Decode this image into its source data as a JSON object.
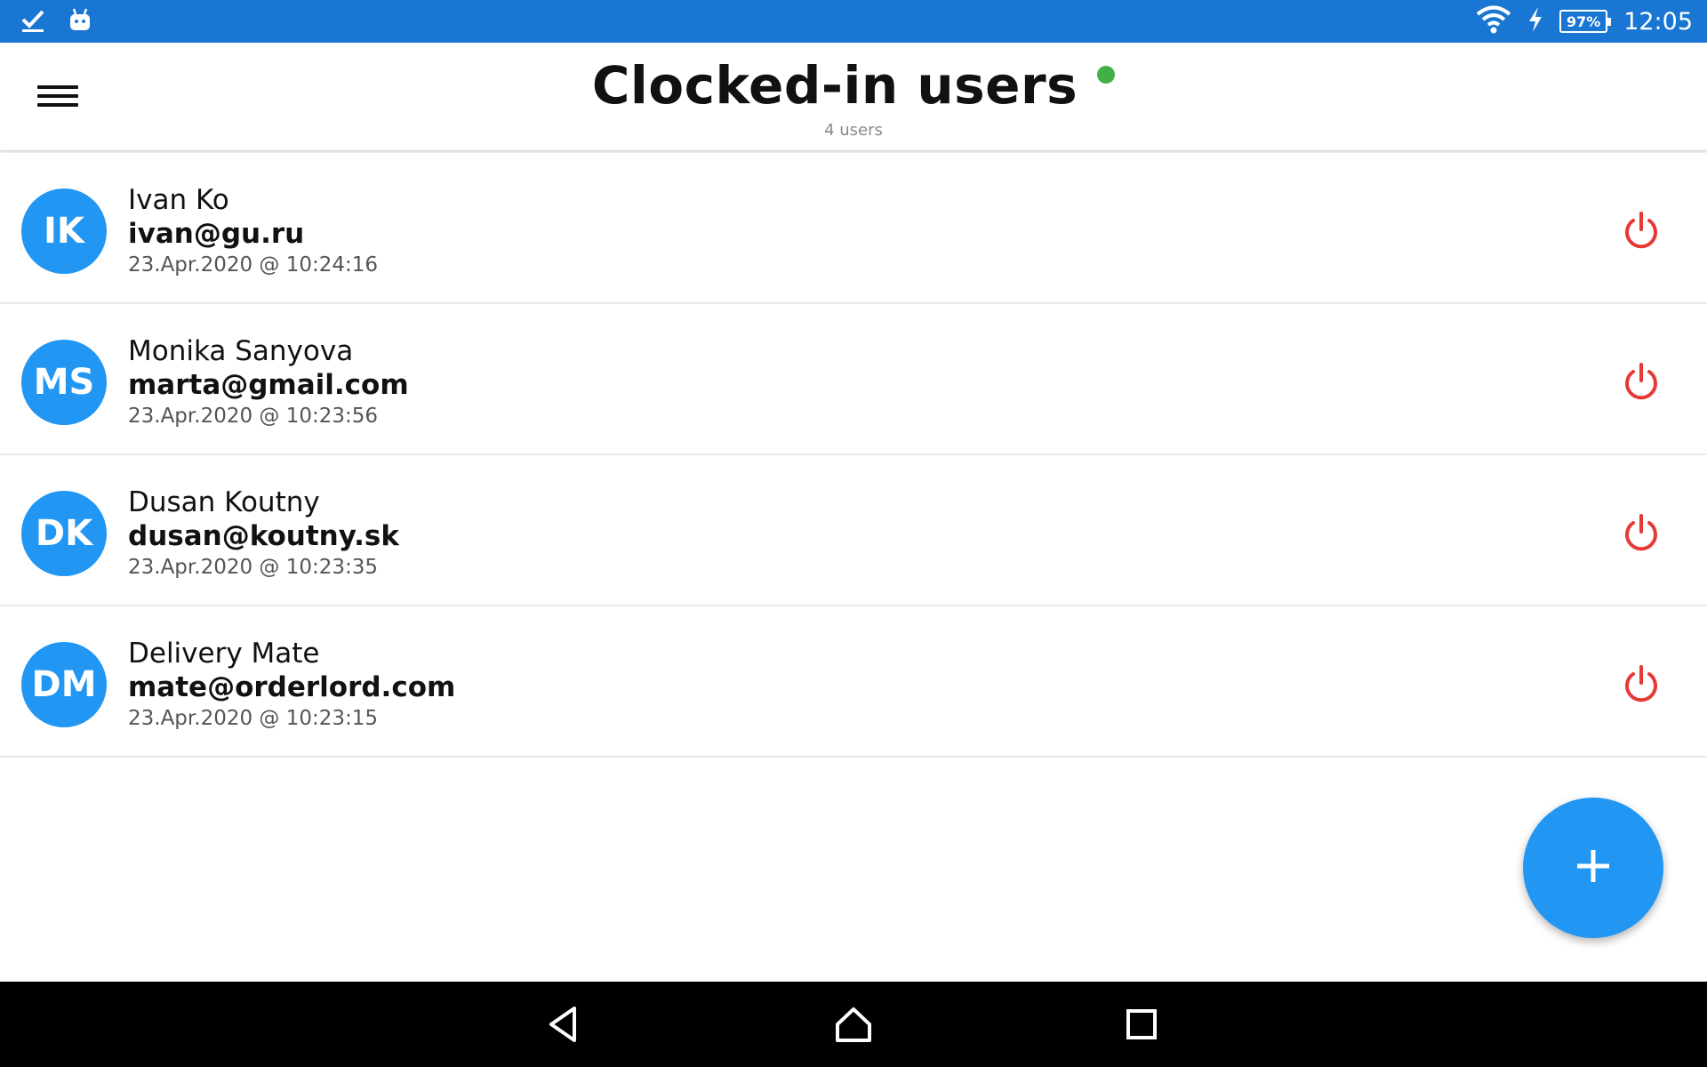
{
  "status_bar": {
    "icons_left": [
      "check-icon",
      "android-icon"
    ],
    "icons_right": [
      "wifi-icon",
      "charging-icon",
      "battery-icon"
    ],
    "battery": "97%",
    "time": "12:05"
  },
  "app_bar": {
    "title": "Clocked-in users",
    "subtitle": "4 users",
    "status_color": "#43b047",
    "menu_icon": "hamburger-menu-icon"
  },
  "users": [
    {
      "initials": "IK",
      "name": "Ivan Ko",
      "email": "ivan@gu.ru",
      "clock_in": "23.Apr.2020 @ 10:24:16"
    },
    {
      "initials": "MS",
      "name": "Monika Sanyova",
      "email": "marta@gmail.com",
      "clock_in": "23.Apr.2020 @ 10:23:56"
    },
    {
      "initials": "DK",
      "name": "Dusan Koutny",
      "email": "dusan@koutny.sk",
      "clock_in": "23.Apr.2020 @ 10:23:35"
    },
    {
      "initials": "DM",
      "name": "Delivery Mate",
      "email": "mate@orderlord.com",
      "clock_in": "23.Apr.2020 @ 10:23:15"
    }
  ],
  "row_action_icon": "power-icon",
  "fab_icon": "plus-icon",
  "colors": {
    "status_bar": "#1976d2",
    "accent": "#2196f3",
    "power": "#e53935",
    "online": "#43b047"
  },
  "nav_bar": {
    "buttons": [
      "back-icon",
      "home-icon",
      "recents-icon"
    ]
  }
}
